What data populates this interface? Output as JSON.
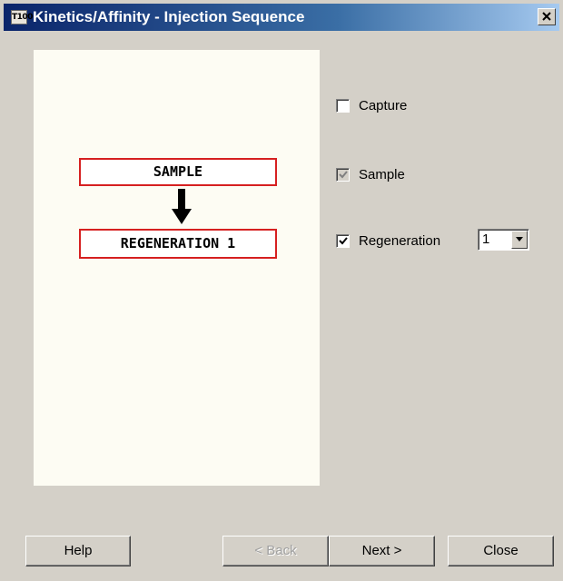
{
  "window": {
    "title": "Kinetics/Affinity - Injection Sequence",
    "icon_text": "T100",
    "icon": "app-icon"
  },
  "preview": {
    "steps": [
      {
        "label": "SAMPLE"
      },
      {
        "label": "REGENERATION 1"
      }
    ],
    "border_color": "#d62020",
    "arrow_icon": "arrow-down-icon"
  },
  "options": {
    "capture": {
      "label": "Capture",
      "checked": false,
      "enabled": true
    },
    "sample": {
      "label": "Sample",
      "checked": true,
      "enabled": false
    },
    "regeneration": {
      "label": "Regeneration",
      "checked": true,
      "enabled": true,
      "count": "1"
    }
  },
  "buttons": {
    "help": "Help",
    "back": "< Back",
    "next": "Next >",
    "close": "Close"
  }
}
